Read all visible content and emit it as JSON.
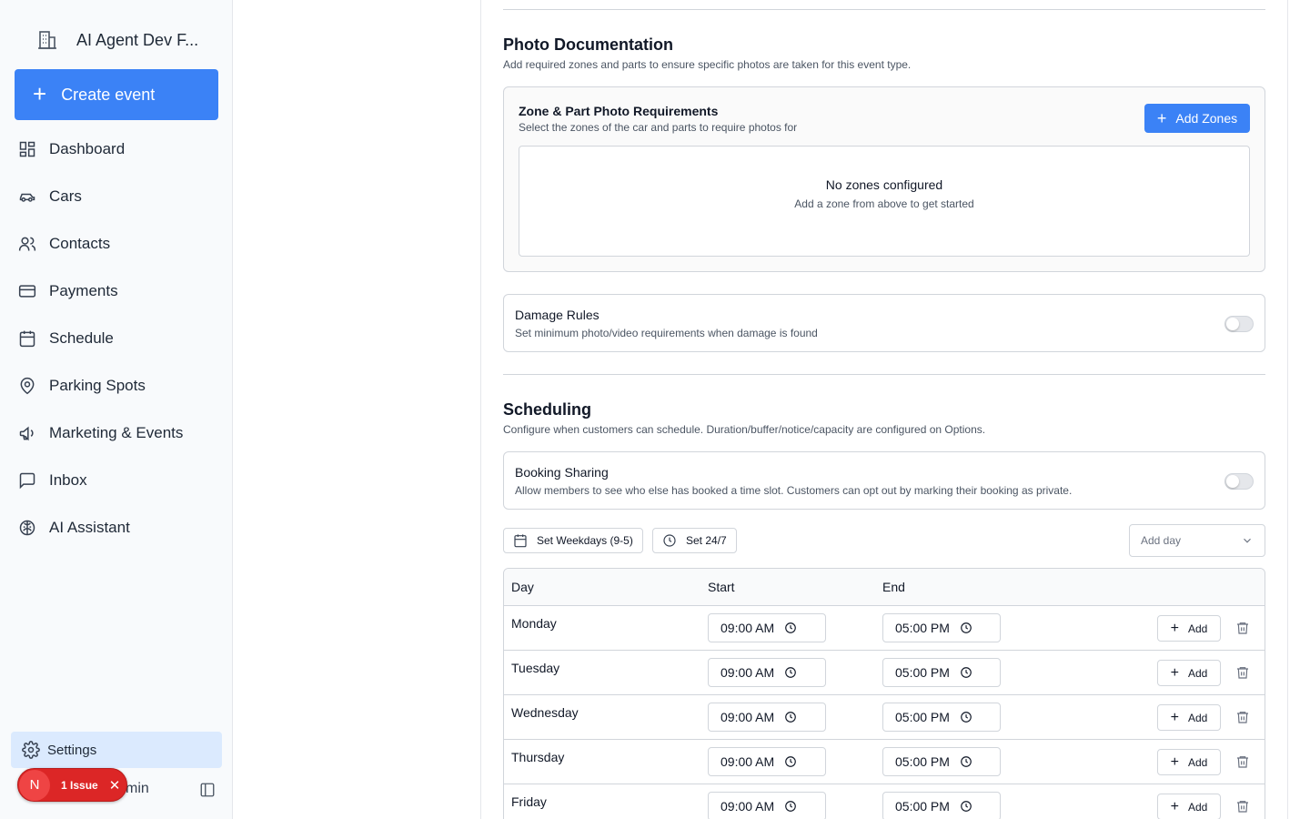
{
  "sidebar": {
    "org_name": "AI Agent Dev F...",
    "create_label": "Create event",
    "items": [
      {
        "label": "Dashboard",
        "icon": "dashboard-icon"
      },
      {
        "label": "Cars",
        "icon": "car-icon"
      },
      {
        "label": "Contacts",
        "icon": "users-icon"
      },
      {
        "label": "Payments",
        "icon": "credit-card-icon"
      },
      {
        "label": "Schedule",
        "icon": "calendar-icon"
      },
      {
        "label": "Parking Spots",
        "icon": "map-pin-icon"
      },
      {
        "label": "Marketing & Events",
        "icon": "megaphone-icon"
      },
      {
        "label": "Inbox",
        "icon": "message-square-icon"
      },
      {
        "label": "AI Assistant",
        "icon": "brain-icon"
      }
    ],
    "settings_label": "Settings",
    "user_suffix": "min",
    "issue_initial": "N",
    "issue_label": "1 Issue",
    "issue_close": "✕"
  },
  "photo": {
    "title": "Photo Documentation",
    "subtitle": "Add required zones and parts to ensure specific photos are taken for this event type.",
    "zone_title": "Zone & Part Photo Requirements",
    "zone_subtitle": "Select the zones of the car and parts to require photos for",
    "add_zones_label": "Add Zones",
    "empty_title": "No zones configured",
    "empty_subtitle": "Add a zone from above to get started"
  },
  "damage": {
    "title": "Damage Rules",
    "subtitle": "Set minimum photo/video requirements when damage is found",
    "enabled": false
  },
  "scheduling": {
    "title": "Scheduling",
    "subtitle": "Configure when customers can schedule. Duration/buffer/notice/capacity are configured on Options.",
    "booking_title": "Booking Sharing",
    "booking_subtitle": "Allow members to see who else has booked a time slot. Customers can opt out by marking their booking as private.",
    "booking_enabled": false,
    "weekdays_label": "Set Weekdays (9-5)",
    "always_label": "Set 24/7",
    "add_day_placeholder": "Add day",
    "columns": [
      "Day",
      "Start",
      "End"
    ],
    "add_label": "Add",
    "rows": [
      {
        "day": "Monday",
        "start": "09:00 AM",
        "end": "05:00 PM"
      },
      {
        "day": "Tuesday",
        "start": "09:00 AM",
        "end": "05:00 PM"
      },
      {
        "day": "Wednesday",
        "start": "09:00 AM",
        "end": "05:00 PM"
      },
      {
        "day": "Thursday",
        "start": "09:00 AM",
        "end": "05:00 PM"
      },
      {
        "day": "Friday",
        "start": "09:00 AM",
        "end": "05:00 PM"
      }
    ]
  },
  "colors": {
    "accent": "#3b82f6",
    "active_nav_bg": "#dbeafe",
    "issue_red": "#dc2626"
  }
}
